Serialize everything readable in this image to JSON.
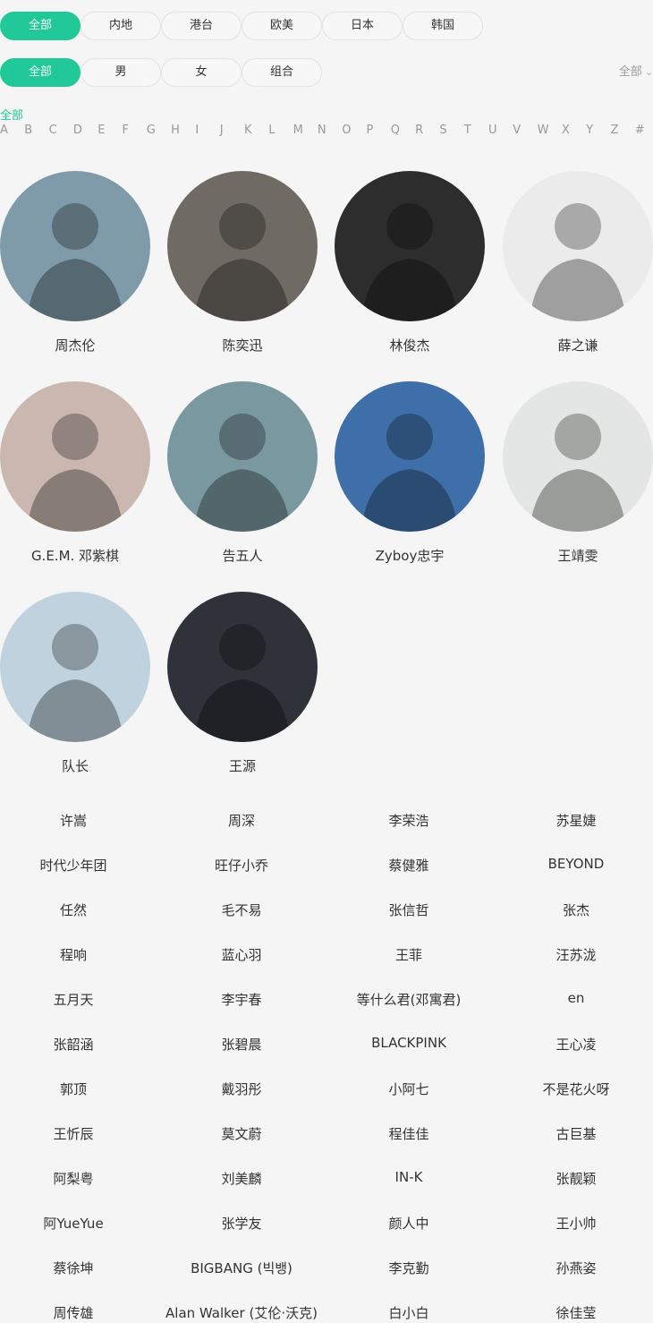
{
  "region_filters": [
    "全部",
    "内地",
    "港台",
    "欧美",
    "日本",
    "韩国"
  ],
  "gender_filters": [
    "全部",
    "男",
    "女",
    "组合"
  ],
  "sort_label": "全部",
  "alpha_all": "全部",
  "letters": [
    "A",
    "B",
    "C",
    "D",
    "E",
    "F",
    "G",
    "H",
    "I",
    "J",
    "K",
    "L",
    "M",
    "N",
    "O",
    "P",
    "Q",
    "R",
    "S",
    "T",
    "U",
    "V",
    "W",
    "X",
    "Y",
    "Z",
    "#"
  ],
  "featured": [
    {
      "name": "周杰伦",
      "bg": "#7f9aa8"
    },
    {
      "name": "陈奕迅",
      "bg": "#6f6a63"
    },
    {
      "name": "林俊杰",
      "bg": "#2d2d2d"
    },
    {
      "name": "薛之谦",
      "bg": "#ebebeb"
    },
    {
      "name": "G.E.M. 邓紫棋",
      "bg": "#c9b7b0"
    },
    {
      "name": "告五人",
      "bg": "#7a98a0"
    },
    {
      "name": "Zyboy忠宇",
      "bg": "#3f6fa8"
    },
    {
      "name": "王靖雯",
      "bg": "#e3e6e4"
    },
    {
      "name": "队长",
      "bg": "#bfd2dd"
    },
    {
      "name": "王源",
      "bg": "#2f3238"
    }
  ],
  "artists": [
    [
      "许嵩",
      "周深",
      "李荣浩",
      "苏星婕"
    ],
    [
      "时代少年团",
      "旺仔小乔",
      "蔡健雅",
      "BEYOND"
    ],
    [
      "任然",
      "毛不易",
      "张信哲",
      "张杰"
    ],
    [
      "程响",
      "蓝心羽",
      "王菲",
      "汪苏泷"
    ],
    [
      "五月天",
      "李宇春",
      "等什么君(邓寓君)",
      "en"
    ],
    [
      "张韶涵",
      "张碧晨",
      "BLACKPINK",
      "王心凌"
    ],
    [
      "郭顶",
      "戴羽彤",
      "小阿七",
      "不是花火呀"
    ],
    [
      "王忻辰",
      "莫文蔚",
      "程佳佳",
      "古巨基"
    ],
    [
      "阿梨粤",
      "刘美麟",
      "IN-K",
      "张靓颖"
    ],
    [
      "阿YueYue",
      "张学友",
      "颜人中",
      "王小帅"
    ],
    [
      "蔡徐坤",
      "BIGBANG (빅뱅)",
      "李克勤",
      "孙燕姿"
    ],
    [
      "周传雄",
      "Alan Walker (艾伦·沃克)",
      "白小白",
      "徐佳莹"
    ]
  ]
}
